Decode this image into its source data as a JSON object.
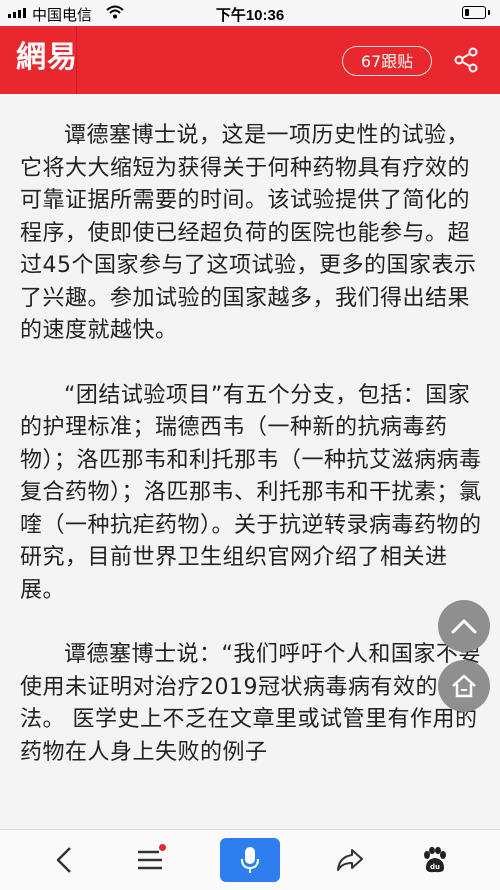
{
  "status_bar": {
    "carrier": "中国电信",
    "time": "下午10:36"
  },
  "header": {
    "logo": "網易",
    "comments_label": "67跟贴"
  },
  "article": {
    "paragraphs": [
      "谭德塞博士说，这是一项历史性的试验，它将大大缩短为获得关于何种药物具有疗效的可靠证据所需要的时间。该试验提供了简化的程序，使即使已经超负荷的医院也能参与。超过45个国家参与了这项试验，更多的国家表示了兴趣。参加试验的国家越多，我们得出结果的速度就越快。",
      "“团结试验项目”有五个分支，包括：国家的护理标准；瑞德西韦（一种新的抗病毒药物）；洛匹那韦和利托那韦（一种抗艾滋病病毒复合药物）；洛匹那韦、利托那韦和干扰素；氯喹（一种抗疟药物）。关于抗逆转录病毒药物的研究，目前世界卫生组织官网介绍了相关进展。",
      "谭德塞博士说：“我们呼吁个人和国家不要使用未证明对治疗2019冠状病毒病有效的疗法。 医学史上不乏在文章里或试管里有作用的药物在人身上失败的例子"
    ]
  },
  "colors": {
    "brand_red": "#e8282e",
    "voice_blue": "#2d7ff0",
    "fab_gray": "#8f8f8f"
  },
  "icons": [
    "signal-icon",
    "wifi-icon",
    "battery-icon",
    "share-nodes-icon",
    "scroll-top-icon",
    "home-icon",
    "back-icon",
    "menu-icon",
    "microphone-icon",
    "forward-share-icon",
    "baidu-paw-icon"
  ]
}
